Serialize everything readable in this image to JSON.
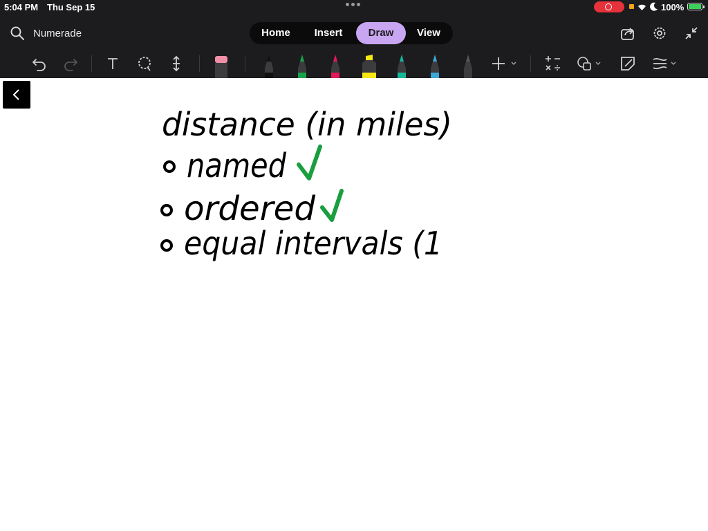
{
  "status_bar": {
    "time": "5:04 PM",
    "date": "Thu Sep 15",
    "battery": "100%",
    "icons": [
      "screen-record-icon",
      "wifi-icon",
      "moon-icon",
      "battery-icon"
    ]
  },
  "header": {
    "app_name": "Numerade",
    "tabs": [
      {
        "label": "Home",
        "active": false
      },
      {
        "label": "Insert",
        "active": false
      },
      {
        "label": "Draw",
        "active": true
      },
      {
        "label": "View",
        "active": false
      }
    ],
    "right_icons": [
      "share-icon",
      "settings-icon",
      "collapse-icon"
    ]
  },
  "toolbar": {
    "tools": [
      "undo-icon",
      "redo-icon",
      "text-tool-icon",
      "lasso-icon",
      "add-space-icon",
      "eraser-icon"
    ],
    "pens": [
      {
        "name": "pen-black",
        "color": "#111111"
      },
      {
        "name": "pen-green",
        "color": "#18a24a"
      },
      {
        "name": "pen-pink",
        "color": "#e0195a"
      },
      {
        "name": "highlighter-yellow",
        "color": "#f5e614"
      },
      {
        "name": "pen-teal",
        "color": "#17b59a"
      },
      {
        "name": "pen-blue",
        "color": "#3aa7d6"
      },
      {
        "name": "pencil-gray",
        "color": "#555555"
      }
    ],
    "extra_tools": [
      "add-pen-icon",
      "math-icon",
      "shapes-icon",
      "ink-to-shape-icon",
      "ruler-icon"
    ]
  },
  "note": {
    "ink_color": "#000000",
    "check_color": "#1a9e3f",
    "lines": [
      {
        "text": "distance (in miles)",
        "check": false
      },
      {
        "text": "named",
        "check": true
      },
      {
        "text": "ordered",
        "check": true
      },
      {
        "text": "equal intervals (1",
        "check": false
      }
    ]
  },
  "colors": {
    "toolbar_bg": "#1c1c1e",
    "active_tab": "#c9a6f2",
    "record": "#e5323b"
  }
}
